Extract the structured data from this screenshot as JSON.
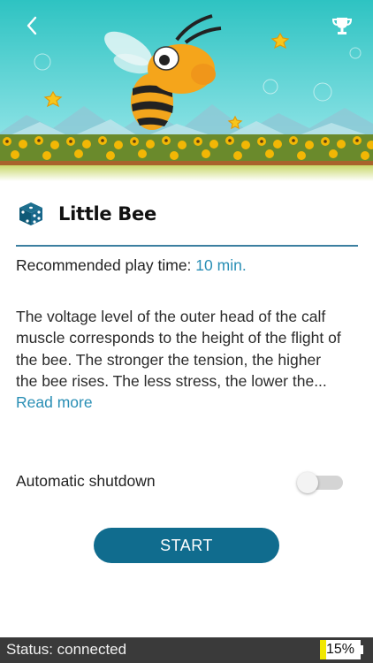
{
  "hero": {
    "back_icon": "chevron-left-icon",
    "trophy_icon": "trophy-icon",
    "scene": "bee-game-illustration"
  },
  "game": {
    "icon": "dice-icon",
    "title": "Little Bee",
    "playtime_label": "Recommended play time: ",
    "playtime_value": "10 min.",
    "description": "The voltage level of the outer head of the calf muscle corresponds to the height of the flight of the bee. The stronger the tension, the higher the bee rises. The less stress, the lower the...",
    "read_more": "Read more"
  },
  "settings": {
    "auto_shutdown_label": "Automatic shutdown",
    "auto_shutdown_on": false
  },
  "actions": {
    "start_label": "START"
  },
  "status": {
    "text": "Status: connected",
    "battery_label": "15%",
    "battery_level": 0.15,
    "battery_color": "#f1e700"
  },
  "colors": {
    "accent": "#106c8e",
    "link": "#2a8fb5",
    "divider": "#3b7fa0",
    "statusbar": "#3a3a3a"
  }
}
